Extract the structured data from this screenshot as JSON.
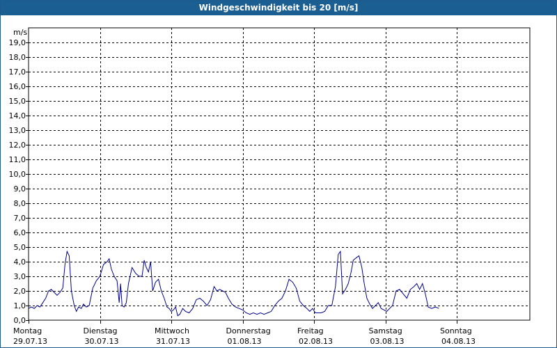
{
  "window": {
    "title": "Windgeschwindigkeit bis 20 [m/s]"
  },
  "colors": {
    "titlebar": "#1b5f92",
    "series": "#00008b",
    "grid": "#000000"
  },
  "chart_data": {
    "type": "line",
    "title": "Windgeschwindigkeit bis 20 [m/s]",
    "ylabel": "m/s",
    "xlabel": "",
    "ylim": [
      0,
      20
    ],
    "xlim": [
      0,
      7
    ],
    "grid": true,
    "y_ticks": [
      "0,0",
      "1,0",
      "2,0",
      "3,0",
      "4,0",
      "5,0",
      "6,0",
      "7,0",
      "8,0",
      "9,0",
      "10,0",
      "11,0",
      "12,0",
      "13,0",
      "14,0",
      "15,0",
      "16,0",
      "17,0",
      "18,0",
      "19,0"
    ],
    "x_ticks": [
      {
        "day": "Montag",
        "date": "29.07.13"
      },
      {
        "day": "Dienstag",
        "date": "30.07.13"
      },
      {
        "day": "Mittwoch",
        "date": "31.07.13"
      },
      {
        "day": "Donnerstag",
        "date": "01.08.13"
      },
      {
        "day": "Freitag",
        "date": "02.08.13"
      },
      {
        "day": "Samstag",
        "date": "03.08.13"
      },
      {
        "day": "Sonntag",
        "date": "04.08.13"
      }
    ],
    "series": [
      {
        "values": [
          [
            0.0,
            0.8
          ],
          [
            0.04,
            0.9
          ],
          [
            0.08,
            0.8
          ],
          [
            0.12,
            1.0
          ],
          [
            0.16,
            0.9
          ],
          [
            0.2,
            1.2
          ],
          [
            0.24,
            1.5
          ],
          [
            0.28,
            2.0
          ],
          [
            0.32,
            2.1
          ],
          [
            0.36,
            1.9
          ],
          [
            0.4,
            1.7
          ],
          [
            0.44,
            1.9
          ],
          [
            0.48,
            2.2
          ],
          [
            0.51,
            3.8
          ],
          [
            0.54,
            4.7
          ],
          [
            0.57,
            4.4
          ],
          [
            0.6,
            2.0
          ],
          [
            0.64,
            1.0
          ],
          [
            0.67,
            0.6
          ],
          [
            0.7,
            0.9
          ],
          [
            0.74,
            0.8
          ],
          [
            0.77,
            1.1
          ],
          [
            0.81,
            0.9
          ],
          [
            0.85,
            1.0
          ],
          [
            0.9,
            2.2
          ],
          [
            0.95,
            2.7
          ],
          [
            1.0,
            3.0
          ],
          [
            1.05,
            3.8
          ],
          [
            1.1,
            4.0
          ],
          [
            1.13,
            4.2
          ],
          [
            1.16,
            3.5
          ],
          [
            1.2,
            3.0
          ],
          [
            1.24,
            2.7
          ],
          [
            1.27,
            1.2
          ],
          [
            1.29,
            2.5
          ],
          [
            1.31,
            1.0
          ],
          [
            1.34,
            0.9
          ],
          [
            1.37,
            1.2
          ],
          [
            1.4,
            2.5
          ],
          [
            1.45,
            3.6
          ],
          [
            1.5,
            3.2
          ],
          [
            1.55,
            3.0
          ],
          [
            1.59,
            3.0
          ],
          [
            1.62,
            4.1
          ],
          [
            1.65,
            3.6
          ],
          [
            1.68,
            3.3
          ],
          [
            1.71,
            4.0
          ],
          [
            1.74,
            2.0
          ],
          [
            1.78,
            2.6
          ],
          [
            1.82,
            2.8
          ],
          [
            1.86,
            2.0
          ],
          [
            1.9,
            1.5
          ],
          [
            1.94,
            0.9
          ],
          [
            1.97,
            0.8
          ],
          [
            2.0,
            0.6
          ],
          [
            2.03,
            0.7
          ],
          [
            2.06,
            0.9
          ],
          [
            2.09,
            0.3
          ],
          [
            2.12,
            0.4
          ],
          [
            2.16,
            0.8
          ],
          [
            2.2,
            0.6
          ],
          [
            2.25,
            0.5
          ],
          [
            2.3,
            0.8
          ],
          [
            2.35,
            1.4
          ],
          [
            2.4,
            1.5
          ],
          [
            2.45,
            1.3
          ],
          [
            2.5,
            1.0
          ],
          [
            2.55,
            1.4
          ],
          [
            2.6,
            2.3
          ],
          [
            2.64,
            2.0
          ],
          [
            2.68,
            2.1
          ],
          [
            2.72,
            2.0
          ],
          [
            2.76,
            1.9
          ],
          [
            2.8,
            1.5
          ],
          [
            2.85,
            1.1
          ],
          [
            2.9,
            0.9
          ],
          [
            2.95,
            0.8
          ],
          [
            3.0,
            0.7
          ],
          [
            3.05,
            0.5
          ],
          [
            3.1,
            0.4
          ],
          [
            3.15,
            0.5
          ],
          [
            3.2,
            0.4
          ],
          [
            3.25,
            0.5
          ],
          [
            3.3,
            0.4
          ],
          [
            3.35,
            0.5
          ],
          [
            3.4,
            0.6
          ],
          [
            3.45,
            1.0
          ],
          [
            3.5,
            1.3
          ],
          [
            3.55,
            1.5
          ],
          [
            3.6,
            2.0
          ],
          [
            3.65,
            2.8
          ],
          [
            3.7,
            2.6
          ],
          [
            3.75,
            2.2
          ],
          [
            3.8,
            1.3
          ],
          [
            3.85,
            1.0
          ],
          [
            3.9,
            0.8
          ],
          [
            3.94,
            0.6
          ],
          [
            3.98,
            0.8
          ],
          [
            4.02,
            0.5
          ],
          [
            4.06,
            0.5
          ],
          [
            4.1,
            0.5
          ],
          [
            4.15,
            0.6
          ],
          [
            4.2,
            1.0
          ],
          [
            4.25,
            1.0
          ],
          [
            4.3,
            2.3
          ],
          [
            4.34,
            4.5
          ],
          [
            4.37,
            4.7
          ],
          [
            4.4,
            1.8
          ],
          [
            4.44,
            2.1
          ],
          [
            4.48,
            2.5
          ],
          [
            4.52,
            3.3
          ],
          [
            4.55,
            4.1
          ],
          [
            4.6,
            4.3
          ],
          [
            4.63,
            4.4
          ],
          [
            4.67,
            3.6
          ],
          [
            4.7,
            2.6
          ],
          [
            4.74,
            1.5
          ],
          [
            4.78,
            1.1
          ],
          [
            4.82,
            0.8
          ],
          [
            4.86,
            1.0
          ],
          [
            4.9,
            1.2
          ],
          [
            4.94,
            0.8
          ],
          [
            4.98,
            0.7
          ],
          [
            5.02,
            0.6
          ],
          [
            5.06,
            0.8
          ],
          [
            5.1,
            1.0
          ],
          [
            5.15,
            2.0
          ],
          [
            5.2,
            2.1
          ],
          [
            5.25,
            1.8
          ],
          [
            5.3,
            1.5
          ],
          [
            5.35,
            2.1
          ],
          [
            5.4,
            2.3
          ],
          [
            5.44,
            2.5
          ],
          [
            5.48,
            2.1
          ],
          [
            5.52,
            2.5
          ],
          [
            5.56,
            1.8
          ],
          [
            5.6,
            0.9
          ],
          [
            5.65,
            0.8
          ],
          [
            5.7,
            0.9
          ],
          [
            5.75,
            0.8
          ]
        ]
      }
    ]
  }
}
